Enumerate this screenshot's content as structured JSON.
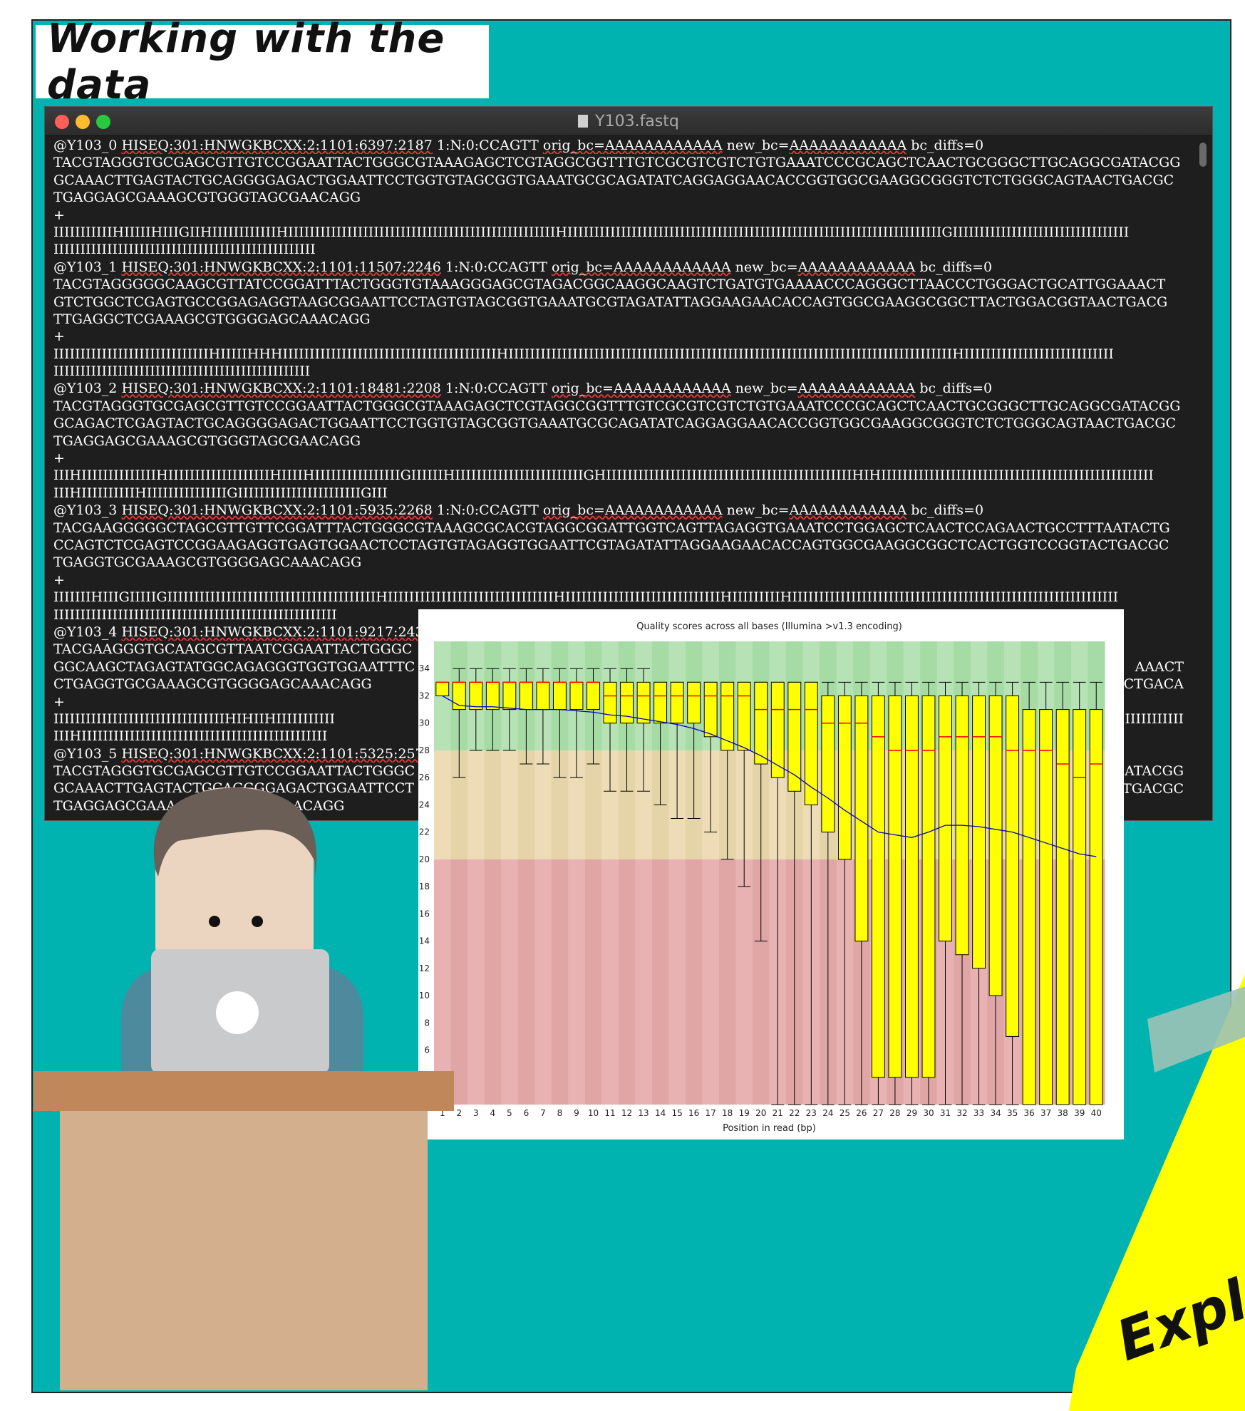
{
  "slide": {
    "title": "Working with the data",
    "corner_note": "Explo"
  },
  "window": {
    "title": "Y103.fastq",
    "file_icon": "document-icon",
    "buttons": [
      "close",
      "minimize",
      "zoom"
    ],
    "colors": {
      "close": "#ff5f57",
      "minimize": "#febc2e",
      "zoom": "#28c840"
    }
  },
  "terminal": {
    "lines": [
      {
        "pre": "@Y103_0 ",
        "u1": "HISEQ:301:HNWGKBCXX:2:1101:6397:2187",
        "mid": " 1:N:0:CCAGTT ",
        "u2": "orig_bc=AAAAAAAAAAAA",
        "mid2": " new_bc=",
        "u3": "AAAAAAAAAAAA",
        "post": " bc_diffs=0"
      },
      {
        "text": "TACGTAGGGTGCGAGCGTTGTCCGGAATTACTGGGCGTAAAGAGCTCGTAGGCGGTTTGTCGCGTCGTCTGTGAAATCCCGCAGCTCAACTGCGGGCTTGCAGGCGATACGG"
      },
      {
        "text": "GCAAACTTGAGTACTGCAGGGGAGACTGGAATTCCTGGTGTAGCGGTGAAATGCGCAGATATCAGGAGGAACACCGGTGGCGAAGGCGGGTCTCTGGGCAGTAACTGACGC"
      },
      {
        "text": "TGAGGAGCGAAAGCGTGGGTAGCGAACAGG"
      },
      {
        "text": "+"
      },
      {
        "text": "IIIIIIIIIIIHIIIIIHIIIGIIHIIIIIIIIIIIIHIIIIIIIIIIIIIIIIIIIIIIIIIIIIIIIIIIIIIIIIIIIIIIIIIIHIIIIIIIIIIIIIIIIIIIIIIIIIIIIIIIIIIIIIIIIIIIIIIIIIIIIIIIIIIIIIIIIIIIIIIGIIIIIIIIIIIIIIIIIIIIIIIIIIIIIIIII"
      },
      {
        "text": "IIIIIIIIIIIIIIIIIIIIIIIIIIIIIIIIIIIIIIIIIIIIIIIII"
      },
      {
        "pre": "@Y103_1 ",
        "u1": "HISEQ:301:HNWGKBCXX:2:1101:11507:2246",
        "mid": " 1:N:0:CCAGTT ",
        "u2": "orig_bc=AAAAAAAAAAAA",
        "mid2": " new_bc=",
        "u3": "AAAAAAAAAAAA",
        "post": " bc_diffs=0"
      },
      {
        "text": "TACGTAGGGGGCAAGCGTTATCCGGATTTACTGGGTGTAAAGGGAGCGTAGACGGCAAGGCAAGTCTGATGTGAAAACCCAGGGCTTAACCCTGGGACTGCATTGGAAACT"
      },
      {
        "text": "GTCTGGCTCGAGTGCCGGAGAGGTAAGCGGAATTCCTAGTGTAGCGGTGAAATGCGTAGATATTAGGAAGAACACCAGTGGCGAAGGCGGCTTACTGGACGGTAACTGACG"
      },
      {
        "text": "TTGAGGCTCGAAAGCGTGGGGAGCAAACAGG"
      },
      {
        "text": "+"
      },
      {
        "text": "IIIIIIIIIIIIIIIIIIIIIIIIIIIIIHIIIIIHHHIIIIIIIIIIIIIIIIIIIIIIIIIIIIIIIIIIIIIIIIHIIIIIIIIIIIIIIIIIIIIIIIIIIIIIIIIIIIIIIIIIIIIIIIIIIIIIIIIIIIIIIIIIIIIIIIIIIIIIIIIIIIHIIIIIIIIIIIIIIIIIIIIIIIIIIII"
      },
      {
        "text": "IIIIIIIIIIIIIIIIIIIIIIIIIIIIIIIIIIIIIIIIIIIIIIII"
      },
      {
        "pre": "@Y103_2 ",
        "u1": "HISEQ:301:HNWGKBCXX:2:1101:18481:2208",
        "mid": " 1:N:0:CCAGTT ",
        "u2": "orig_bc=AAAAAAAAAAAA",
        "mid2": " new_bc=",
        "u3": "AAAAAAAAAAAA",
        "post": " bc_diffs=0"
      },
      {
        "text": "TACGTAGGGTGCGAGCGTTGTCCGGAATTACTGGGCGTAAAGAGCTCGTAGGCGGTTTGTCGCGTCGTCTGTGAAATCCCGCAGCTCAACTGCGGGCTTGCAGGCGATACGG"
      },
      {
        "text": "GCAGACTCGAGTACTGCAGGGGAGACTGGAATTCCTGGTGTAGCGGTGAAATGCGCAGATATCAGGAGGAACACCGGTGGCGAAGGCGGGTCTCTGGGCAGTAACTGACGC"
      },
      {
        "text": "TGAGGAGCGAAAGCGTGGGTAGCGAACAGG"
      },
      {
        "text": "+"
      },
      {
        "text": "IIIHIIIIIIIIIIIIIIHIIIIIIIIIIIIIIIIIIIHIIIIHIIIIIIIIIIIIIIIIGIIIIIIHIIIIIIIIIIIIIIIIIIIIIIIIGHIIIIIIIIIIIIIIIIIIIIIIIIIIIIIIIIIIIIIIIIIIIIIIHIHIIIIIIIIIIIIIIIIIIIIIIIIIIIIIIIIIIIIIIIIIIIIIIIIIII"
      },
      {
        "text": "IIIHIIIIIIIIIIHIIIIIIIIIIIIIIIGIIIIIIIIIIIIIIIIIIIIIIIGIII"
      },
      {
        "pre": "@Y103_3 ",
        "u1": "HISEQ:301:HNWGKBCXX:2:1101:5935:2268",
        "mid": " 1:N:0:CCAGTT ",
        "u2": "orig_bc=AAAAAAAAAAAA",
        "mid2": " new_bc=",
        "u3": "AAAAAAAAAAAA",
        "post": " bc_diffs=0"
      },
      {
        "text": "TACGAAGGGGGCTAGCGTTGTTCGGATTTACTGGGCGTAAAGCGCACGTAGGCGGATTGGTCAGTTAGAGGTGAAATCCTGGAGCTCAACTCCAGAACTGCCTTTAATACTG"
      },
      {
        "text": "CCAGTCTCGAGTCCGGAAGAGGTGAGTGGAACTCCTAGTGTAGAGGTGGAATTCGTAGATATTAGGAAGAACACCAGTGGCGAAGGCGGCTCACTGGTCCGGTACTGACGC"
      },
      {
        "text": "TGAGGTGCGAAAGCGTGGGGAGCAAACAGG"
      },
      {
        "text": "+"
      },
      {
        "text": "IIIIIIIHIIIGIIIIIGIIIIIIIIIIIIIIIIIIIIIIIIIIIIIIIIIIIIIIIHIIIIIIIIIIIIIIIIIIIIIIIIIIIIIIIHIIIIIIIIIIIIIIIIIIIIIIIIIIIIIHIIIIIIIIIHIIIIIIIIIIIIIIIIIIIIIIIIIIIIIIIIIIIIIIIIIIIIIIIIIIIIIIIIIIIII"
      },
      {
        "text": "IIIIIIIIIIIIIIIIIIIIIIIIIIIIIIIIIIIIIIIIIIIIIIIIIIIII"
      },
      {
        "pre": "@Y103_4 ",
        "u1": "HISEQ:301:HNWGKBCXX:2:1101:9217:2438",
        "mid": "",
        "u2": "",
        "mid2": "",
        "u3": "",
        "post": "                                                                                              "
      },
      {
        "text": "TACGAAGGGTGCAAGCGTTAATCGGAATTACTGGGC"
      },
      {
        "text": "GGCAAGCTAGAGTATGGCAGAGGGTGGTGGAATTTC"
      },
      {
        "text": "CTGAGGTGCGAAAGCGTGGGGAGCAAACAGG"
      },
      {
        "text": "+"
      },
      {
        "text": "IIIIIIIIIIIIIIIIIIIIIIIIIIIIIIIIHIHIIHIIIIIIIIIII"
      },
      {
        "text": "IIIHIIIIIIIIIIIIIIIIIIIIIIIIIIIIIIIIIIIIIIIIIIIIII"
      },
      {
        "pre": "@Y103_5 ",
        "u1": "HISEQ:301:HNWGKBCXX:2:1101:5325:2570",
        "mid": "",
        "u2": "",
        "mid2": "",
        "u3": "",
        "post": ""
      },
      {
        "text": "TACGTAGGGTGCGAGCGTTGTCCGGAATTACTGGGC"
      },
      {
        "text": "GCAAACTTGAGTACTGCAGGGGAGACTGGAATTCCT"
      },
      {
        "text": "TGAGGAGCGAAA                    CGAACAGG"
      }
    ],
    "right_fragments": [
      {
        "row": 30,
        "text": "AAACT"
      },
      {
        "row": 31,
        "text": "CTGACA"
      },
      {
        "row": 33,
        "text": "IIIIIIIIIII"
      },
      {
        "row": 36,
        "text": "ATACGG"
      },
      {
        "row": 37,
        "text": "TGACGC"
      }
    ]
  },
  "chart_data": {
    "type": "box",
    "title": "Quality scores across all bases (Illumina >v1.3 encoding)",
    "xlabel": "Position in read (bp)",
    "ylabel": "",
    "ylim": [
      2,
      36
    ],
    "yticks": [
      4,
      6,
      8,
      10,
      12,
      14,
      16,
      18,
      20,
      22,
      24,
      26,
      28,
      30,
      32,
      34
    ],
    "x": [
      1,
      2,
      3,
      4,
      5,
      6,
      7,
      8,
      9,
      10,
      11,
      12,
      13,
      14,
      15,
      16,
      17,
      18,
      19,
      20,
      21,
      22,
      23,
      24,
      25,
      26,
      27,
      28,
      29,
      30,
      31,
      32,
      33,
      34,
      35,
      36,
      37,
      38,
      39,
      40
    ],
    "box_q1": [
      32,
      31,
      31,
      31,
      31,
      31,
      31,
      31,
      31,
      31,
      30,
      30,
      30,
      30,
      30,
      30,
      29,
      28,
      28,
      27,
      26,
      25,
      24,
      22,
      20,
      14,
      4,
      4,
      4,
      4,
      14,
      13,
      12,
      10,
      7,
      2,
      2,
      2,
      2,
      2
    ],
    "box_q3": [
      33,
      33,
      33,
      33,
      33,
      33,
      33,
      33,
      33,
      33,
      33,
      33,
      33,
      33,
      33,
      33,
      33,
      33,
      33,
      33,
      33,
      33,
      33,
      32,
      32,
      32,
      32,
      32,
      32,
      32,
      32,
      32,
      32,
      32,
      32,
      31,
      31,
      31,
      31,
      31
    ],
    "median": [
      33,
      33,
      33,
      33,
      33,
      33,
      33,
      33,
      33,
      33,
      32,
      32,
      32,
      32,
      32,
      32,
      32,
      32,
      32,
      31,
      31,
      31,
      31,
      30,
      30,
      30,
      29,
      28,
      28,
      28,
      29,
      29,
      29,
      29,
      28,
      28,
      28,
      27,
      26,
      27
    ],
    "whisker_low": [
      32,
      26,
      28,
      28,
      28,
      27,
      27,
      26,
      26,
      27,
      25,
      25,
      25,
      24,
      23,
      23,
      22,
      20,
      18,
      14,
      2,
      2,
      2,
      2,
      2,
      2,
      2,
      2,
      2,
      2,
      2,
      2,
      2,
      2,
      2,
      2,
      2,
      2,
      2,
      2
    ],
    "whisker_high": [
      33,
      34,
      34,
      34,
      34,
      34,
      34,
      34,
      34,
      34,
      34,
      34,
      34,
      33,
      33,
      33,
      33,
      33,
      33,
      33,
      33,
      33,
      33,
      33,
      33,
      33,
      33,
      33,
      33,
      33,
      33,
      33,
      33,
      33,
      33,
      33,
      33,
      33,
      33,
      33
    ],
    "mean": [
      32.0,
      31.3,
      31.2,
      31.2,
      31.1,
      31.0,
      31.0,
      31.0,
      30.9,
      30.8,
      30.6,
      30.5,
      30.3,
      30.1,
      29.9,
      29.6,
      29.2,
      28.7,
      28.2,
      27.6,
      26.9,
      26.2,
      25.3,
      24.5,
      23.6,
      22.8,
      22.0,
      21.8,
      21.6,
      22.0,
      22.5,
      22.5,
      22.4,
      22.2,
      22.0,
      21.6,
      21.2,
      20.8,
      20.4,
      20.2
    ],
    "zones": {
      "good": [
        28,
        36
      ],
      "ok": [
        20,
        28
      ],
      "poor": [
        2,
        20
      ]
    },
    "colors": {
      "box": "#ffff00",
      "median": "#ff0000",
      "mean": "#0000cc",
      "good": "#b6e2b5",
      "good_alt": "#a6dba5",
      "ok": "#eedcb6",
      "ok_alt": "#e4d4a8",
      "poor": "#e8b2b2",
      "poor_alt": "#e0a6a6"
    }
  }
}
